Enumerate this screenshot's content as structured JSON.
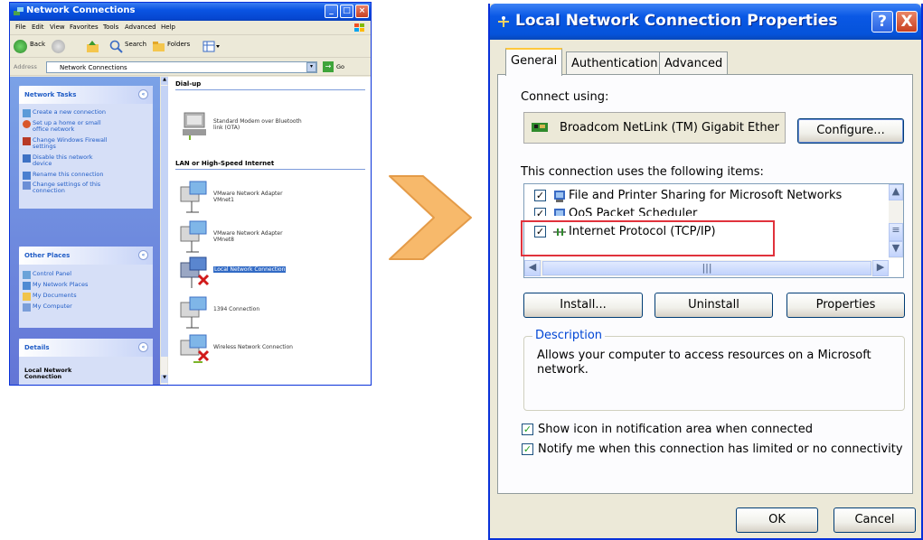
{
  "explorer": {
    "title": "Network Connections",
    "menu": [
      "File",
      "Edit",
      "View",
      "Favorites",
      "Tools",
      "Advanced",
      "Help"
    ],
    "toolbar": {
      "back": "Back",
      "search": "Search",
      "folders": "Folders"
    },
    "address": {
      "label": "Address",
      "value": "Network Connections",
      "go": "Go"
    },
    "network_tasks": {
      "title": "Network Tasks",
      "items": [
        "Create a new connection",
        "Set up a home or small\noffice network",
        "Change Windows Firewall\nsettings",
        "Disable this network\ndevice",
        "Rename this connection",
        "Change settings of this\nconnection"
      ]
    },
    "other_places": {
      "title": "Other Places",
      "items": [
        "Control Panel",
        "My Network Places",
        "My Documents",
        "My Computer"
      ]
    },
    "details": {
      "title": "Details",
      "text": "Local Network\nConnection"
    },
    "groups": {
      "dialup": "Dial-up",
      "lan": "LAN or High-Speed Internet"
    },
    "connections": [
      "Standard Modem over Bluetooth\nlink (OTA)",
      "VMware Network Adapter\nVMnet1",
      "VMware Network Adapter\nVMnet8",
      "Local Network Connection",
      "1394 Connection",
      "Wireless Network Connection"
    ]
  },
  "dialog": {
    "title": "Local Network Connection Properties",
    "help_btn": "?",
    "close_btn": "X",
    "tabs": [
      "General",
      "Authentication",
      "Advanced"
    ],
    "connect_using_label": "Connect using:",
    "adapter": "Broadcom NetLink (TM) Gigabit Ether",
    "configure": "Configure...",
    "items_label": "This connection uses the following items:",
    "items": [
      "File and Printer Sharing for Microsoft Networks",
      "QoS Packet Scheduler",
      "Internet Protocol (TCP/IP)"
    ],
    "highlight_color": "#e0323c",
    "install": "Install...",
    "uninstall": "Uninstall",
    "properties": "Properties",
    "description_label": "Description",
    "description_text": "Allows your computer to access resources on a Microsoft network.",
    "show_icon": "Show icon in notification area when connected",
    "notify": "Notify me when this connection has limited or no connectivity",
    "ok": "OK",
    "cancel": "Cancel"
  },
  "arrow_color": "#f7b96b"
}
